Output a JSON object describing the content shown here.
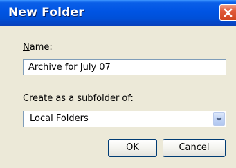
{
  "dialog": {
    "title": "New Folder",
    "close_icon": "close-icon"
  },
  "name_field": {
    "label_mnemonic": "N",
    "label_rest": "ame:",
    "value": "Archive for July 07"
  },
  "parent_field": {
    "label_mnemonic": "C",
    "label_rest": "reate as a subfolder of:",
    "value": "Local Folders",
    "arrow_icon": "chevron-down-icon"
  },
  "buttons": {
    "ok": "OK",
    "cancel": "Cancel"
  },
  "colors": {
    "titlebar": "#0054e3",
    "dialog_bg": "#ece9d8",
    "close_red": "#e0593a"
  }
}
